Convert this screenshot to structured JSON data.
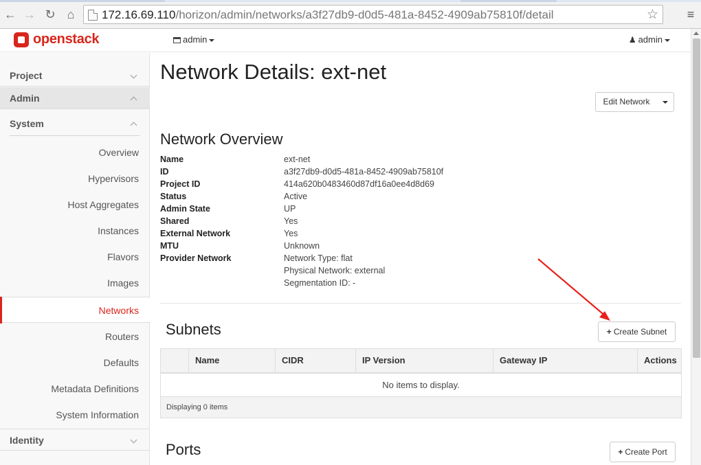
{
  "browser": {
    "url_host": "172.16.69.110",
    "url_path": "/horizon/admin/networks/a3f27db9-d0d5-481a-8452-4909ab75810f/detail",
    "back_icon": "back-arrow-icon",
    "forward_icon": "forward-arrow-icon",
    "reload_icon": "reload-icon",
    "home_icon": "home-icon"
  },
  "navbar": {
    "brand": "openstack",
    "project": "admin",
    "user": "admin"
  },
  "sidebar": {
    "panels": [
      {
        "label": "Project"
      },
      {
        "label": "Admin"
      },
      {
        "label": "System"
      }
    ],
    "items": [
      {
        "label": "Overview"
      },
      {
        "label": "Hypervisors"
      },
      {
        "label": "Host Aggregates"
      },
      {
        "label": "Instances"
      },
      {
        "label": "Flavors"
      },
      {
        "label": "Images"
      },
      {
        "label": "Networks"
      },
      {
        "label": "Routers"
      },
      {
        "label": "Defaults"
      },
      {
        "label": "Metadata Definitions"
      },
      {
        "label": "System Information"
      }
    ],
    "identity": "Identity"
  },
  "main": {
    "title": "Network Details: ext-net",
    "edit_button": "Edit Network",
    "overview_title": "Network Overview",
    "details": [
      {
        "label": "Name",
        "value": "ext-net"
      },
      {
        "label": "ID",
        "value": "a3f27db9-d0d5-481a-8452-4909ab75810f"
      },
      {
        "label": "Project ID",
        "value": "414a620b0483460d87df16a0ee4d8d69"
      },
      {
        "label": "Status",
        "value": "Active"
      },
      {
        "label": "Admin State",
        "value": "UP"
      },
      {
        "label": "Shared",
        "value": "Yes"
      },
      {
        "label": "External Network",
        "value": "Yes"
      },
      {
        "label": "MTU",
        "value": "Unknown"
      },
      {
        "label": "Provider Network",
        "value": "Network Type: flat"
      },
      {
        "label": "",
        "value": "Physical Network: external"
      },
      {
        "label": "",
        "value": "Segmentation ID: -"
      }
    ],
    "subnets": {
      "title": "Subnets",
      "create_button": "Create Subnet",
      "columns": [
        "Name",
        "CIDR",
        "IP Version",
        "Gateway IP",
        "Actions"
      ],
      "empty_text": "No items to display.",
      "footer": "Displaying 0 items"
    },
    "ports": {
      "title": "Ports",
      "create_button": "Create Port"
    }
  },
  "colors": {
    "brand": "#d9261c",
    "annotation_arrow": "#e8201a"
  }
}
